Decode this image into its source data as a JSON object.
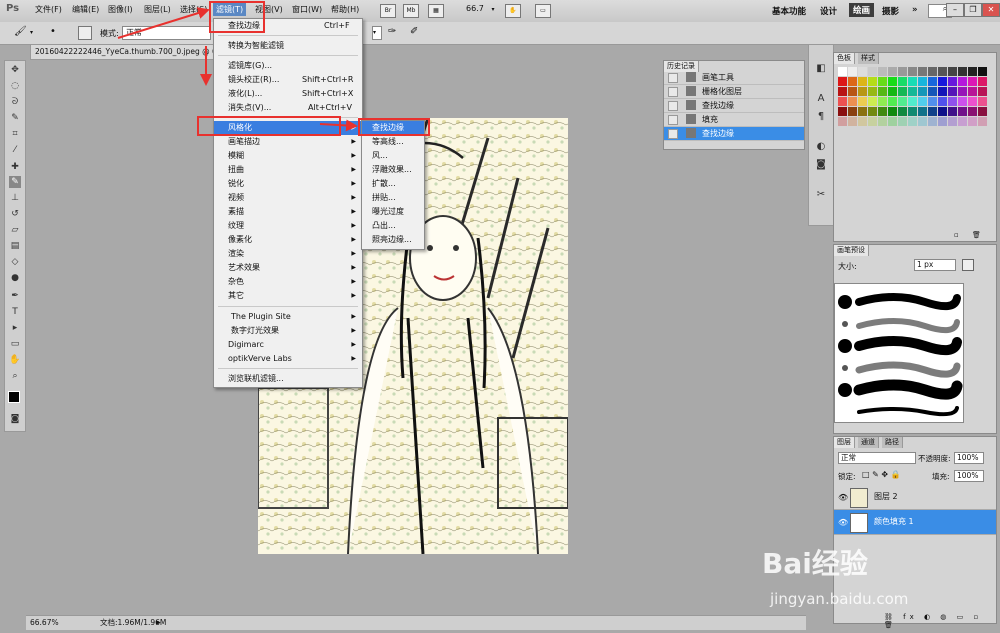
{
  "menubar": {
    "items": [
      "文件(F)",
      "编辑(E)",
      "图像(I)",
      "图层(L)",
      "选择(S)",
      "滤镜(T)",
      "视图(V)",
      "窗口(W)",
      "帮助(H)"
    ],
    "zoom": "66.7",
    "workspaces": [
      "基本功能",
      "设计",
      "绘画",
      "摄影"
    ],
    "more": "»"
  },
  "options_bar": {
    "mode_label": "模式:",
    "mode_value": "正常"
  },
  "document": {
    "tab_title": "20160422222446_YyeCa.thumb.700_0.jpeg @ 66.7%"
  },
  "filter_menu": {
    "items": [
      {
        "label": "查找边缘",
        "shortcut": "Ctrl+F"
      },
      {
        "label": "转换为智能滤镜",
        "shortcut": ""
      },
      {
        "label": "滤镜库(G)...",
        "shortcut": ""
      },
      {
        "label": "镜头校正(R)...",
        "shortcut": "Shift+Ctrl+R"
      },
      {
        "label": "液化(L)...",
        "shortcut": "Shift+Ctrl+X"
      },
      {
        "label": "消失点(V)...",
        "shortcut": "Alt+Ctrl+V"
      },
      {
        "label": "风格化",
        "shortcut": ""
      },
      {
        "label": "画笔描边",
        "shortcut": ""
      },
      {
        "label": "模糊",
        "shortcut": ""
      },
      {
        "label": "扭曲",
        "shortcut": ""
      },
      {
        "label": "锐化",
        "shortcut": ""
      },
      {
        "label": "视频",
        "shortcut": ""
      },
      {
        "label": "素描",
        "shortcut": ""
      },
      {
        "label": "纹理",
        "shortcut": ""
      },
      {
        "label": "像素化",
        "shortcut": ""
      },
      {
        "label": "渲染",
        "shortcut": ""
      },
      {
        "label": "艺术效果",
        "shortcut": ""
      },
      {
        "label": "杂色",
        "shortcut": ""
      },
      {
        "label": "其它",
        "shortcut": ""
      },
      {
        "label": "The Plugin Site",
        "shortcut": ""
      },
      {
        "label": "数字灯光效果",
        "shortcut": ""
      },
      {
        "label": "Digimarc",
        "shortcut": ""
      },
      {
        "label": "optikVerve Labs",
        "shortcut": ""
      },
      {
        "label": "浏览联机滤镜...",
        "shortcut": ""
      }
    ]
  },
  "stylize_submenu": {
    "items": [
      "查找边缘",
      "等高线...",
      "风...",
      "浮雕效果...",
      "扩散...",
      "拼贴...",
      "曝光过度",
      "凸出...",
      "照亮边缘..."
    ]
  },
  "swatches_panel": {
    "tabs": [
      "色板",
      "样式"
    ]
  },
  "history_panel": {
    "title": "历史记录",
    "items": [
      "画笔工具",
      "栅格化图层",
      "查找边缘",
      "填充",
      "查找边缘"
    ]
  },
  "brush_presets_panel": {
    "title": "画笔预设",
    "size_label": "大小:",
    "size_value": "1 px"
  },
  "layers_panel": {
    "tabs": [
      "图层",
      "通道",
      "路径"
    ],
    "blend_mode": "正常",
    "opacity_label": "不透明度:",
    "opacity_value": "100%",
    "lock_label": "锁定:",
    "fill_label": "填充:",
    "fill_value": "100%",
    "layers": [
      "图层 2",
      "颜色填充 1"
    ]
  },
  "status_bar": {
    "zoom": "66.67%",
    "doc_info": "文档:1.96M/1.96M"
  },
  "watermark": {
    "brand": "Bai经验",
    "url": "jingyan.baidu.com"
  },
  "colors": {
    "menu_highlight": "#3a7ee0",
    "annotation_red": "#e8312e",
    "layer_selected": "#3a8de6"
  }
}
